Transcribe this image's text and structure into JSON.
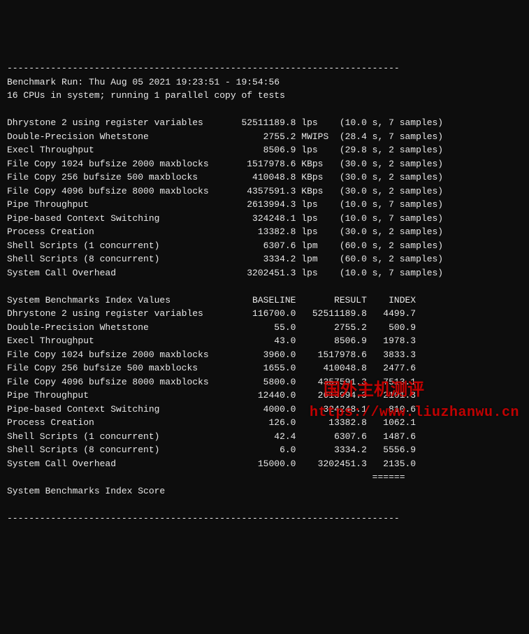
{
  "hr": "------------------------------------------------------------------------",
  "header": {
    "run_line": "Benchmark Run: Thu Aug 05 2021 19:23:51 - 19:54:56",
    "cpu_line": "16 CPUs in system; running 1 parallel copy of tests"
  },
  "results": [
    {
      "name": "Dhrystone 2 using register variables",
      "value": "52511189.8",
      "unit": "lps",
      "timing": "(10.0 s, 7 samples)"
    },
    {
      "name": "Double-Precision Whetstone",
      "value": "2755.2",
      "unit": "MWIPS",
      "timing": "(28.4 s, 7 samples)"
    },
    {
      "name": "Execl Throughput",
      "value": "8506.9",
      "unit": "lps",
      "timing": "(29.8 s, 2 samples)"
    },
    {
      "name": "File Copy 1024 bufsize 2000 maxblocks",
      "value": "1517978.6",
      "unit": "KBps",
      "timing": "(30.0 s, 2 samples)"
    },
    {
      "name": "File Copy 256 bufsize 500 maxblocks",
      "value": "410048.8",
      "unit": "KBps",
      "timing": "(30.0 s, 2 samples)"
    },
    {
      "name": "File Copy 4096 bufsize 8000 maxblocks",
      "value": "4357591.3",
      "unit": "KBps",
      "timing": "(30.0 s, 2 samples)"
    },
    {
      "name": "Pipe Throughput",
      "value": "2613994.3",
      "unit": "lps",
      "timing": "(10.0 s, 7 samples)"
    },
    {
      "name": "Pipe-based Context Switching",
      "value": "324248.1",
      "unit": "lps",
      "timing": "(10.0 s, 7 samples)"
    },
    {
      "name": "Process Creation",
      "value": "13382.8",
      "unit": "lps",
      "timing": "(30.0 s, 2 samples)"
    },
    {
      "name": "Shell Scripts (1 concurrent)",
      "value": "6307.6",
      "unit": "lpm",
      "timing": "(60.0 s, 2 samples)"
    },
    {
      "name": "Shell Scripts (8 concurrent)",
      "value": "3334.2",
      "unit": "lpm",
      "timing": "(60.0 s, 2 samples)"
    },
    {
      "name": "System Call Overhead",
      "value": "3202451.3",
      "unit": "lps",
      "timing": "(10.0 s, 7 samples)"
    }
  ],
  "index_header": {
    "title": "System Benchmarks Index Values",
    "col_baseline": "BASELINE",
    "col_result": "RESULT",
    "col_index": "INDEX"
  },
  "index_rows": [
    {
      "name": "Dhrystone 2 using register variables",
      "baseline": "116700.0",
      "result": "52511189.8",
      "index": "4499.7"
    },
    {
      "name": "Double-Precision Whetstone",
      "baseline": "55.0",
      "result": "2755.2",
      "index": "500.9"
    },
    {
      "name": "Execl Throughput",
      "baseline": "43.0",
      "result": "8506.9",
      "index": "1978.3"
    },
    {
      "name": "File Copy 1024 bufsize 2000 maxblocks",
      "baseline": "3960.0",
      "result": "1517978.6",
      "index": "3833.3"
    },
    {
      "name": "File Copy 256 bufsize 500 maxblocks",
      "baseline": "1655.0",
      "result": "410048.8",
      "index": "2477.6"
    },
    {
      "name": "File Copy 4096 bufsize 8000 maxblocks",
      "baseline": "5800.0",
      "result": "4357591.3",
      "index": "7513.1"
    },
    {
      "name": "Pipe Throughput",
      "baseline": "12440.0",
      "result": "2613994.3",
      "index": "2101.3"
    },
    {
      "name": "Pipe-based Context Switching",
      "baseline": "4000.0",
      "result": "324248.1",
      "index": "810.6"
    },
    {
      "name": "Process Creation",
      "baseline": "126.0",
      "result": "13382.8",
      "index": "1062.1"
    },
    {
      "name": "Shell Scripts (1 concurrent)",
      "baseline": "42.4",
      "result": "6307.6",
      "index": "1487.6"
    },
    {
      "name": "Shell Scripts (8 concurrent)",
      "baseline": "6.0",
      "result": "3334.2",
      "index": "5556.9"
    },
    {
      "name": "System Call Overhead",
      "baseline": "15000.0",
      "result": "3202451.3",
      "index": "2135.0"
    }
  ],
  "footer": {
    "score_label": "System Benchmarks Index Score"
  },
  "watermark": {
    "cn": "国外主机测评",
    "url": "https://www.liuzhanwu.cn"
  }
}
